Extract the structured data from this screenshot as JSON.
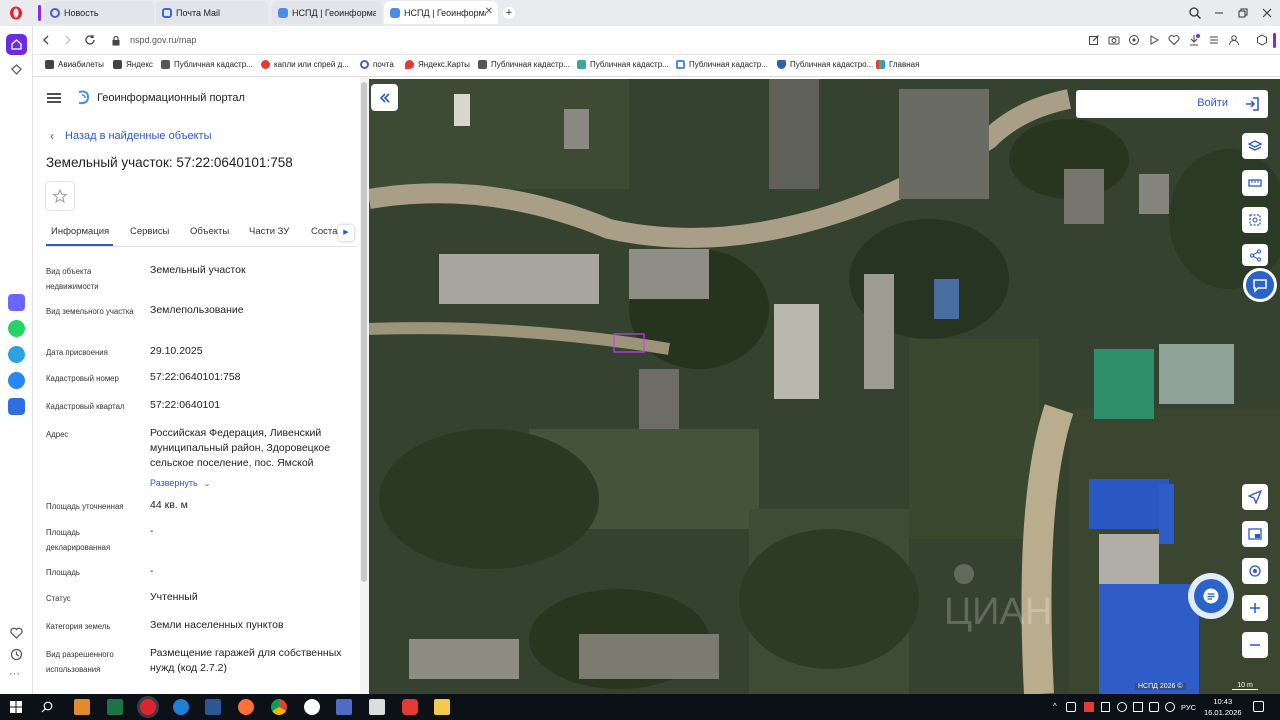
{
  "browser": {
    "tabs": [
      {
        "label": "Новость",
        "icon": "news-icon"
      },
      {
        "label": "Почта Mail",
        "icon": "mail-icon"
      },
      {
        "label": "НСПД | Геоинформацио",
        "icon": "nspd-icon"
      },
      {
        "label": "НСПД | Геоинформацио",
        "icon": "nspd-icon",
        "active": true
      }
    ],
    "url": "nspd.gov.ru/map",
    "bookmarks": [
      {
        "label": "Авиабилеты"
      },
      {
        "label": "Яндекс"
      },
      {
        "label": "Публичная кадастр..."
      },
      {
        "label": "капли или спрей д..."
      },
      {
        "label": "почта"
      },
      {
        "label": "Яндекс.Карты"
      },
      {
        "label": "Публичная кадастр..."
      },
      {
        "label": "Публичная кадастр..."
      },
      {
        "label": "Публичная кадастр..."
      },
      {
        "label": "Публичная кадастро..."
      },
      {
        "label": "Главная"
      }
    ]
  },
  "panel": {
    "portal_title": "Геоинформационный портал",
    "back_label": "Назад в найденные объекты",
    "object_title": "Земельный участок: 57:22:0640101:758",
    "tabs": [
      "Информация",
      "Сервисы",
      "Объекты",
      "Части ЗУ",
      "Соста"
    ],
    "expand_label": "Развернуть",
    "fields": [
      {
        "key": "Вид объекта недвижимости",
        "value": "Земельный участок"
      },
      {
        "key": "Вид земельного участка",
        "value": "Землепользование"
      },
      {
        "key": "Дата присвоения",
        "value": "29.10.2025"
      },
      {
        "key": "Кадастровый номер",
        "value": "57:22:0640101:758"
      },
      {
        "key": "Кадастровый квартал",
        "value": "57:22:0640101"
      },
      {
        "key": "Адрес",
        "value": "Российская Федерация, Ливенский муниципальный район, Здоровецкое сельское поселение, пос. Ямской"
      },
      {
        "key": "Площадь уточненная",
        "value": "44 кв. м"
      },
      {
        "key": "Площадь декларированная",
        "value": "-"
      },
      {
        "key": "Площадь",
        "value": "-"
      },
      {
        "key": "Статус",
        "value": "Учтенный"
      },
      {
        "key": "Категория земель",
        "value": "Земли населенных пунктов"
      },
      {
        "key": "Вид разрешенного использования",
        "value": "Размещение гаражей для собственных нужд (код 2.7.2)"
      }
    ]
  },
  "map": {
    "login_label": "Войти",
    "attribution": "НСПД 2026 ©",
    "scale_label": "10 m",
    "highlight_color": "#c73cff"
  },
  "taskbar": {
    "lang": "РУС",
    "time": "10:43",
    "date": "16.01.2026"
  },
  "colors": {
    "accent": "#2b58c8",
    "opera_red": "#e0232e"
  }
}
